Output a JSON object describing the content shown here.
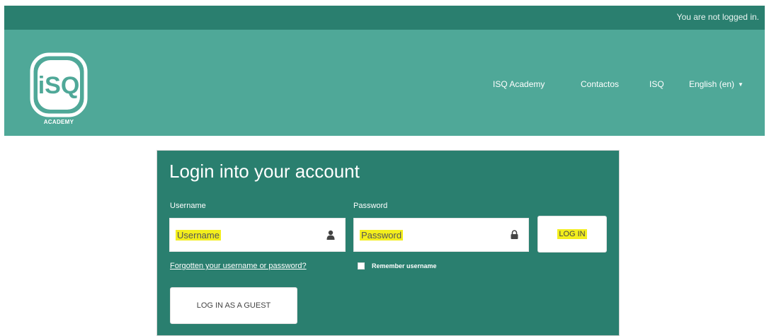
{
  "topbar": {
    "status_text": "You are not logged in."
  },
  "brand": {
    "logo_text": "iSQ",
    "logo_sub": "ACADEMY"
  },
  "nav": {
    "items": [
      "ISQ Academy",
      "Contactos",
      "ISQ",
      "English (en)"
    ]
  },
  "login": {
    "title": "Login into your account",
    "username_label": "Username",
    "username_placeholder": "Username",
    "password_label": "Password",
    "password_placeholder": "Password",
    "login_button": "LOG IN",
    "forgot_link": "Forgotten your username or password?",
    "remember_label": "Remember username",
    "guest_button": "LOG IN AS A GUEST"
  },
  "colors": {
    "topbar": "#2a7f6f",
    "navbar": "#4fa898",
    "card": "#2a7f6f",
    "highlight": "#f3ee1d"
  },
  "icons": {
    "username": "user-icon",
    "password": "lock-icon",
    "language": "caret-down-icon"
  }
}
